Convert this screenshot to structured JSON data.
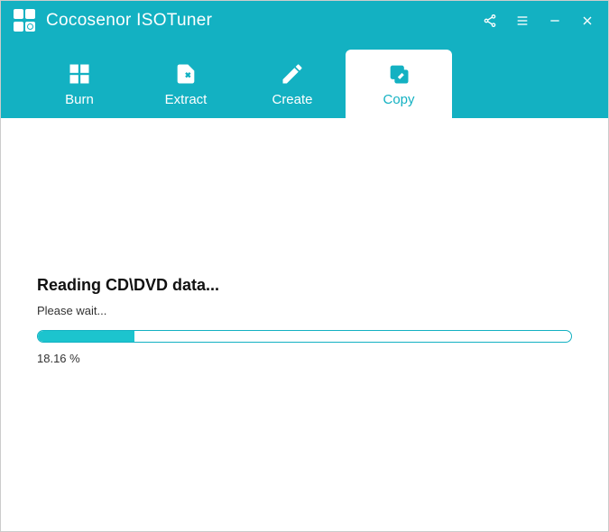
{
  "app": {
    "title": "Cocosenor ISOTuner"
  },
  "tabs": [
    {
      "id": "burn",
      "label": "Burn",
      "active": false
    },
    {
      "id": "extract",
      "label": "Extract",
      "active": false
    },
    {
      "id": "create",
      "label": "Create",
      "active": false
    },
    {
      "id": "copy",
      "label": "Copy",
      "active": true
    }
  ],
  "progress": {
    "title": "Reading CD\\DVD data...",
    "subtitle": "Please wait...",
    "percent_value": 18.16,
    "percent_text": "18.16 %"
  },
  "colors": {
    "accent": "#13b1c2",
    "progress_fill": "#1cc4ce"
  }
}
